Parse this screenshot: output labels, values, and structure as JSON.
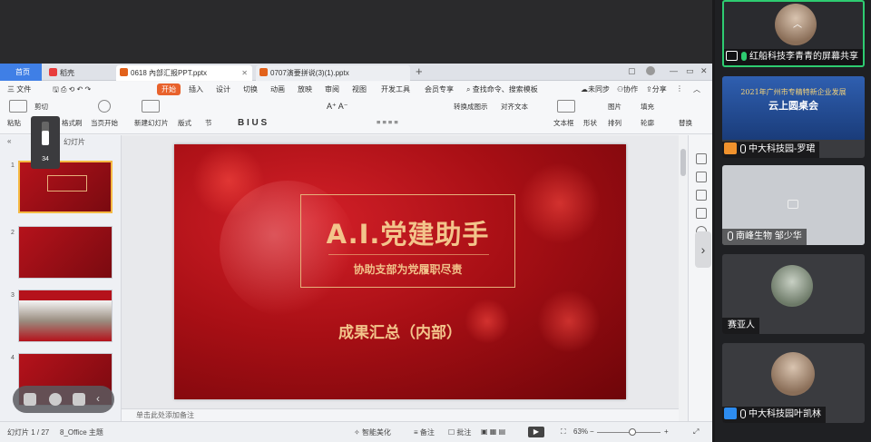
{
  "tabs": {
    "home": "首页",
    "wps": "稻壳",
    "active_file": "0618 內部汇报PPT.pptx",
    "second_file": "0707演要拼说(3)(1).pptx"
  },
  "menu": {
    "file": "三 文件",
    "start": "开始",
    "insert": "插入",
    "design": "设计",
    "switch": "切换",
    "animation": "动画",
    "slideshow": "放映",
    "review": "审阅",
    "view": "视图",
    "devtools": "开发工具",
    "member": "会员专享",
    "search": "查找命令、搜索模板",
    "unsync": "未同步",
    "collab": "协作",
    "share": "分享"
  },
  "ribbon": {
    "paste": "粘贴",
    "cut": "剪切",
    "format_painter": "格式刷",
    "from_current": "当页开始",
    "new_slide": "新建幻灯片",
    "layout": "版式",
    "section": "节",
    "textbox": "文本框",
    "shape": "形状",
    "arrange": "排列",
    "outline": "轮廓",
    "smart_shape": "转换成图示",
    "align_text": "对齐文本",
    "picture": "图片",
    "fill": "填充",
    "replace": "替换"
  },
  "left_pane": {
    "tab_slides": "幻灯片"
  },
  "slide": {
    "title": "A.I.党建助手",
    "subtitle": "协助支部为党履职尽责",
    "footer": "成果汇总（内部）"
  },
  "notes_placeholder": "单击此处添加备注",
  "status": {
    "slide_count": "幻灯片 1 / 27",
    "theme": "8_Office 主题",
    "smart_beautify": "智能美化",
    "notes": "备注",
    "comments": "批注",
    "zoom": "63%"
  },
  "volume": {
    "value": "34",
    "level": 0.6
  },
  "participants": [
    {
      "name": "红船科技李青青的屏幕共享",
      "role": "sharing"
    },
    {
      "name": "中大科技园-罗珺"
    },
    {
      "name": "南峰生物 邹少华"
    },
    {
      "name": "赛亚人"
    },
    {
      "name": "中大科技园叶凯林"
    }
  ],
  "conference_banner": {
    "line1": "2021年广州市专精特新企业发展",
    "line2": "云上圆桌会"
  }
}
